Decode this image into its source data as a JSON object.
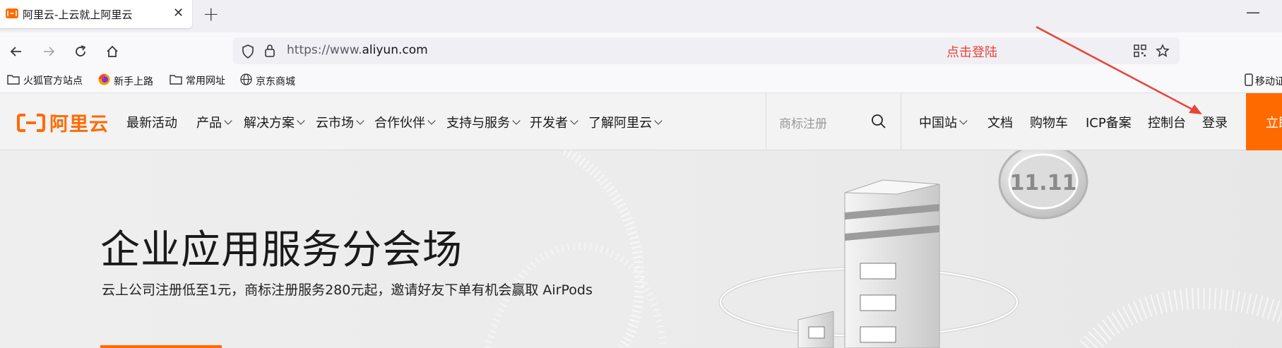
{
  "browser": {
    "tab_title": "阿里云-上云就上阿里云",
    "url_host": "https://www.",
    "url_domain": "aliyun.com",
    "annotation": "点击登陆",
    "bookmarks": [
      {
        "label": "火狐官方站点",
        "icon": "folder-icon"
      },
      {
        "label": "新手上路",
        "icon": "firefox-icon"
      },
      {
        "label": "常用网址",
        "icon": "folder-icon"
      },
      {
        "label": "京东商城",
        "icon": "globe-icon"
      }
    ],
    "bookmark_right": "移动证"
  },
  "site": {
    "logo_text": "阿里云",
    "nav": [
      "最新活动",
      "产品",
      "解决方案",
      "云市场",
      "合作伙伴",
      "支持与服务",
      "开发者",
      "了解阿里云"
    ],
    "search_placeholder": "商标注册",
    "right": [
      "中国站",
      "文档",
      "购物车",
      "ICP备案",
      "控制台",
      "登录"
    ],
    "cta_label": "立即",
    "accent": "#ff6a00"
  },
  "hero": {
    "title": "企业应用服务分会场",
    "subtitle": "云上公司注册低至1元，商标注册服务280元起，邀请好友下单有机会赢取 AirPods",
    "badge_text": "11.11"
  }
}
